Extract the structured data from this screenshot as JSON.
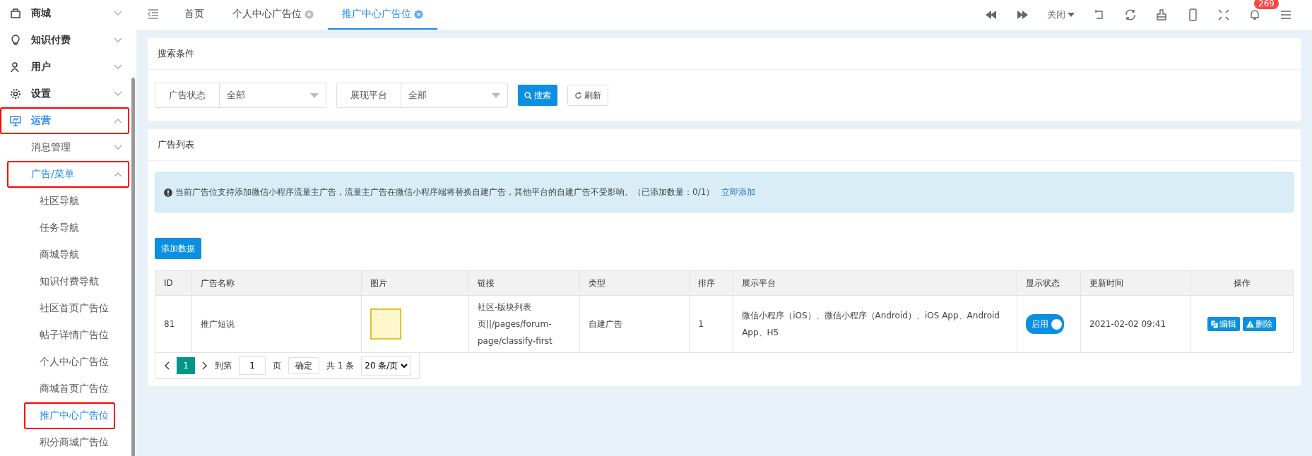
{
  "sidebar": {
    "items": [
      {
        "label": "商城",
        "expanded": false,
        "selected": false,
        "highlighted": false
      },
      {
        "label": "知识付费",
        "expanded": false,
        "selected": false,
        "highlighted": false
      },
      {
        "label": "用户",
        "expanded": false,
        "selected": false,
        "highlighted": false
      },
      {
        "label": "设置",
        "expanded": false,
        "selected": false,
        "highlighted": false
      },
      {
        "label": "运营",
        "expanded": true,
        "selected": true,
        "highlighted": true,
        "children": [
          {
            "label": "消息管理",
            "expanded": false,
            "selected": false,
            "highlighted": false
          },
          {
            "label": "广告/菜单",
            "expanded": true,
            "selected": true,
            "highlighted": true,
            "children": [
              {
                "label": "社区导航",
                "selected": false,
                "highlighted": false
              },
              {
                "label": "任务导航",
                "selected": false,
                "highlighted": false
              },
              {
                "label": "商城导航",
                "selected": false,
                "highlighted": false
              },
              {
                "label": "知识付费导航",
                "selected": false,
                "highlighted": false
              },
              {
                "label": "社区首页广告位",
                "selected": false,
                "highlighted": false
              },
              {
                "label": "帖子详情广告位",
                "selected": false,
                "highlighted": false
              },
              {
                "label": "个人中心广告位",
                "selected": false,
                "highlighted": false
              },
              {
                "label": "商城首页广告位",
                "selected": false,
                "highlighted": false
              },
              {
                "label": "推广中心广告位",
                "selected": true,
                "highlighted": true
              },
              {
                "label": "积分商城广告位",
                "selected": false,
                "highlighted": false
              }
            ]
          }
        ]
      }
    ]
  },
  "tabs": [
    {
      "label": "首页",
      "closable": false,
      "selected": false
    },
    {
      "label": "个人中心广告位",
      "closable": true,
      "selected": false
    },
    {
      "label": "推广中心广告位",
      "closable": true,
      "selected": true
    }
  ],
  "toolbar": {
    "close_menu": "关闭",
    "notification_count": "269"
  },
  "search_panel": {
    "title": "搜索条件",
    "filters": [
      {
        "label": "广告状态",
        "value": "全部"
      },
      {
        "label": "展现平台",
        "value": "全部"
      }
    ],
    "search_button": "搜索",
    "refresh_button": "刷新"
  },
  "ad_list": {
    "title": "广告列表",
    "notice": "当前广告位支持添加微信小程序流量主广告，流量主广告在微信小程序端将替换自建广告，其他平台的自建广告不受影响。（已添加数量：0/1）",
    "notice_link": "立即添加",
    "add_button": "添加数据",
    "columns": [
      "ID",
      "广告名称",
      "图片",
      "链接",
      "类型",
      "排序",
      "展示平台",
      "显示状态",
      "更新时间",
      "操作"
    ],
    "rows": [
      {
        "id": "81",
        "name": "推广短说",
        "link": "社区-版块列表页||/pages/forum-page/classify-first",
        "type": "自建广告",
        "sort": "1",
        "platforms": "微信小程序（iOS）、微信小程序（Android）、iOS App、Android App、H5",
        "status_label": "启用",
        "on": true,
        "updated": "2021-02-02 09:41",
        "edit": "编辑",
        "delete": "删除"
      }
    ],
    "pagination": {
      "pages": [
        {
          "label": "1",
          "selected": true
        }
      ],
      "goto_label": "到第",
      "goto_value": "1",
      "page_unit": "页",
      "confirm": "确定",
      "total": "共 1 条",
      "page_size": "20 条/页"
    }
  }
}
